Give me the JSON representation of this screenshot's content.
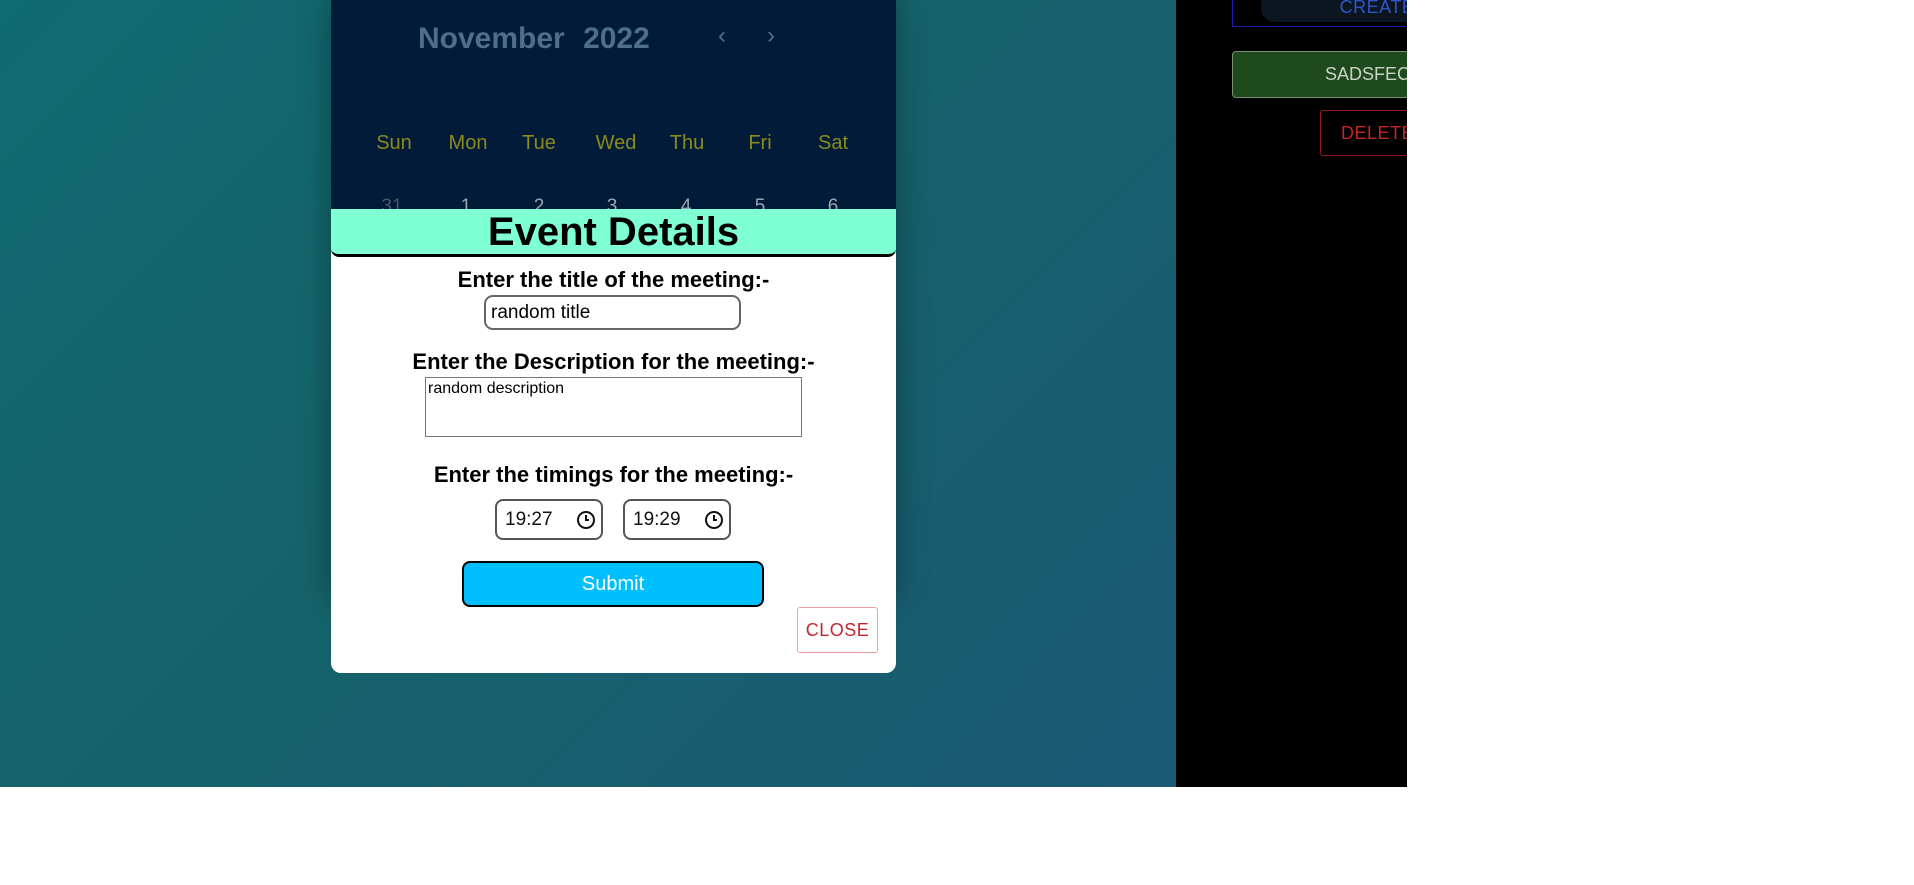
{
  "sidebar": {
    "create_label": "CREATE",
    "event_label": "SADSFEC",
    "delete_label": "DELETE"
  },
  "calendar": {
    "month": "November",
    "year": "2022",
    "prev_icon": "chevron-left-icon",
    "next_icon": "chevron-right-icon",
    "weekdays": [
      "Sun",
      "Mon",
      "Tue",
      "Wed",
      "Thu",
      "Fri",
      "Sat"
    ],
    "first_row": [
      "31",
      "1",
      "2",
      "3",
      "4",
      "5",
      "6"
    ]
  },
  "modal": {
    "title": "Event Details",
    "title_label": "Enter the title of the meeting:-",
    "title_value": "random title",
    "description_label": "Enter the Description for the meeting:-",
    "description_value": "random description",
    "timings_label": "Enter the timings for the meeting:-",
    "start_time": "19:27",
    "end_time": "19:29",
    "submit_label": "Submit",
    "close_label": "CLOSE"
  },
  "colors": {
    "header_bg": "#7fffd4",
    "submit_bg": "#00bfff",
    "calendar_bg": "#021b38",
    "close_text": "#c0282d"
  }
}
